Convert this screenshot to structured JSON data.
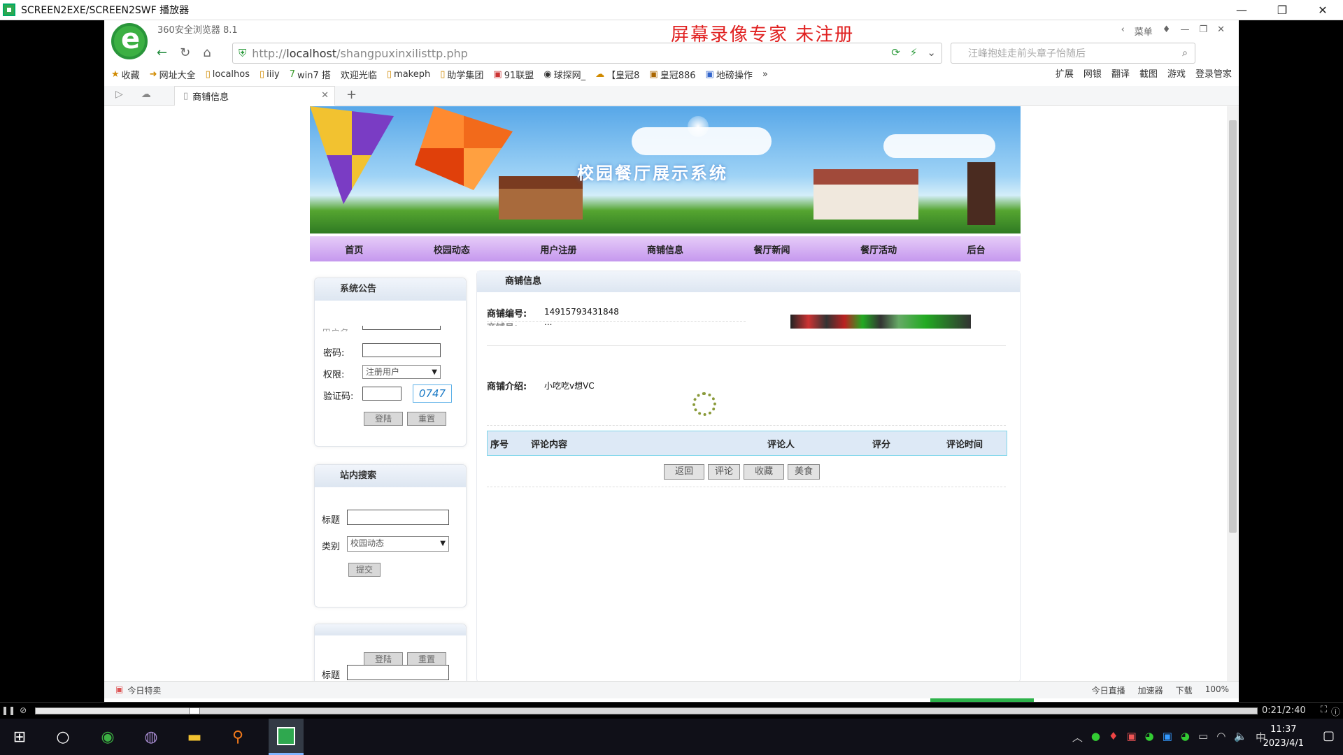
{
  "player": {
    "title": "SCREEN2EXE/SCREEN2SWF 播放器",
    "min": "—",
    "max": "❐",
    "close": "✕",
    "timecode": "0:21/2:40",
    "progress": 0.13
  },
  "browser": {
    "name": "360安全浏览器 8.1",
    "watermark": "屏幕录像专家  未注册",
    "top_menu": "菜单",
    "url_host": "http://",
    "url_main": "localhost",
    "url_path": "/shangpuxinxilisttp.php",
    "search_placeholder": "汪峰抱娃走前头章子怡随后",
    "bookmarks": [
      "收藏",
      "网址大全",
      "localhos",
      "iiiy",
      "win7 搭",
      "欢迎光临",
      "makeph",
      "助学集团",
      "91联盟",
      "球探网_",
      "【皇冠8",
      "皇冠886",
      "地磅操作",
      "»"
    ],
    "bm_right": [
      "扩展",
      "网银",
      "翻译",
      "截图",
      "游戏",
      "登录管家"
    ],
    "tab_title": "商铺信息",
    "status_left": "今日特卖",
    "status_right": [
      "今日直播",
      "加速器",
      "下载",
      "100%"
    ]
  },
  "site": {
    "banner_title": "校园餐厅展示系统",
    "menu": [
      "首页",
      "校园动态",
      "用户注册",
      "商铺信息",
      "餐厅新闻",
      "餐厅活动",
      "后台"
    ],
    "login_panel": {
      "title": "系统公告",
      "username_label": "用户名:",
      "password_label": "密码:",
      "role_label": "权限:",
      "role_value": "注册用户",
      "captcha_label": "验证码:",
      "captcha_value": "0747",
      "login_btn": "登陆",
      "reset_btn": "重置"
    },
    "search_panel": {
      "title": "站内搜索",
      "title_label": "标题",
      "category_label": "类别",
      "category_value": "校园动态",
      "submit_btn": "提交"
    },
    "ghost_panel": {
      "login_btn": "登陆",
      "reset_btn": "重置",
      "title_label": "标题"
    },
    "main": {
      "title": "商铺信息",
      "shop_no_label": "商铺编号:",
      "shop_no_value": "14915793431848",
      "shop_name_label": "商铺号:",
      "shop_name_value": "...",
      "intro_label": "商铺介绍:",
      "intro_value": "小吃吃v想VC",
      "columns": [
        "序号",
        "评论内容",
        "评论人",
        "评分",
        "评论时间"
      ],
      "buttons": [
        "返回",
        "评论",
        "收藏",
        "美食"
      ]
    }
  },
  "ime": {
    "lang": "CH",
    "punct": "°,"
  },
  "taskbar": {
    "time": "11:37",
    "date": "2023/4/1",
    "ime_indicator": "中"
  }
}
